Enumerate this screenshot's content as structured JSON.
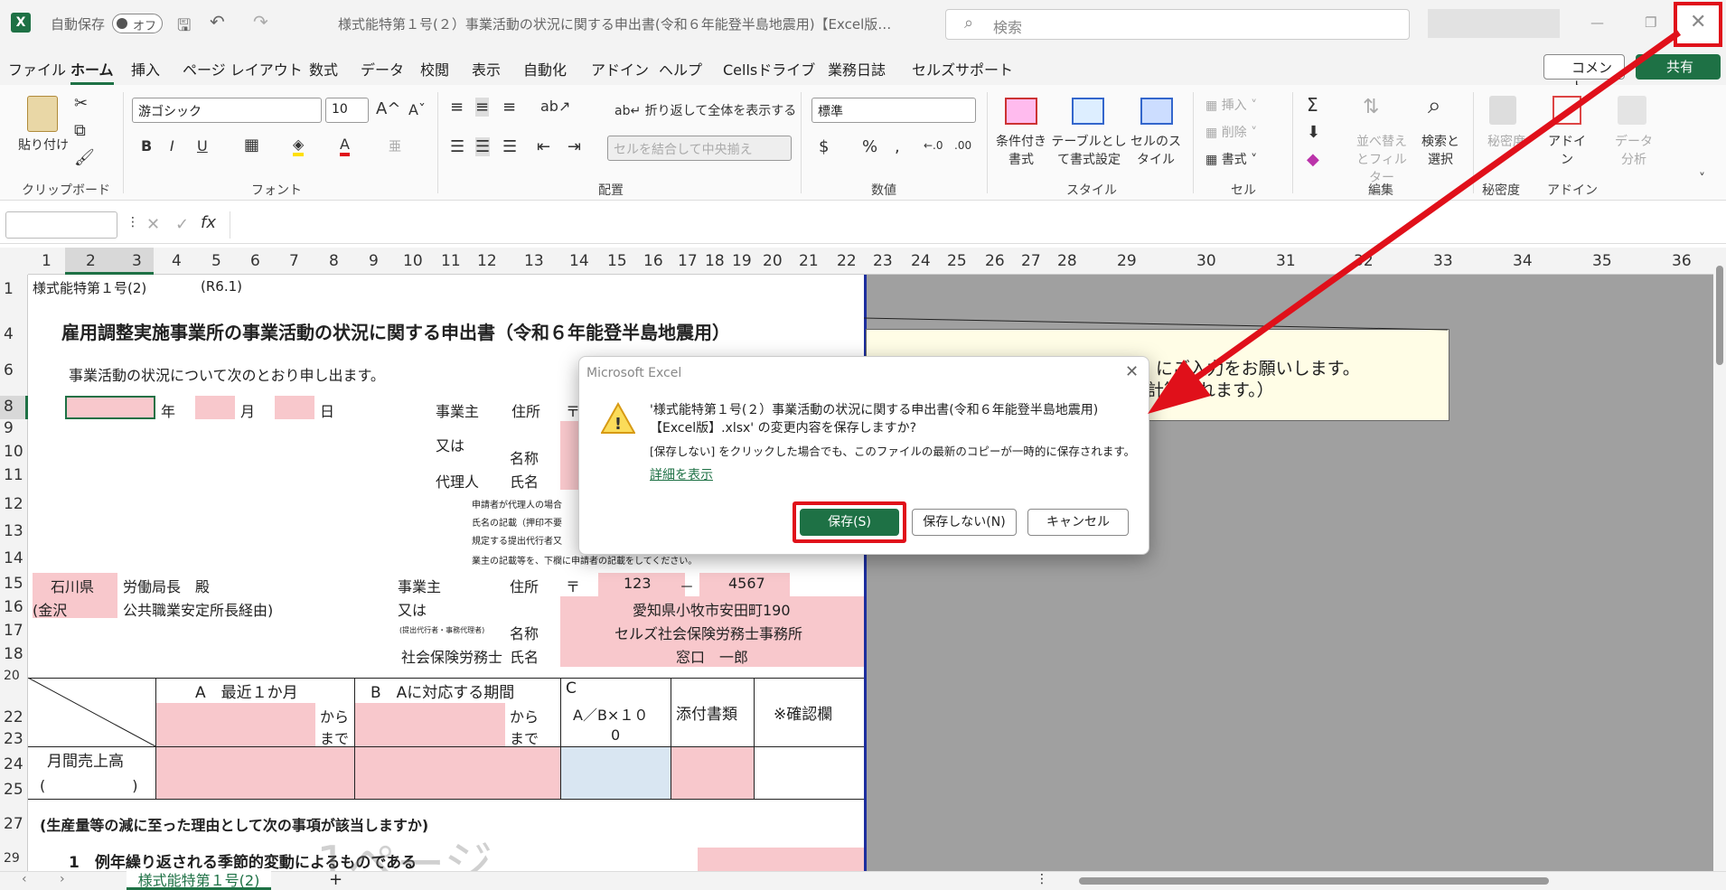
{
  "titlebar": {
    "autosave_label": "自動保存",
    "toggle_state": "オフ",
    "doc_title": "様式能特第１号(２）事業活動の状況に関する申出書(令和６年能登半島地震用)【Excel版…",
    "search_placeholder": "検索"
  },
  "menu": {
    "items": [
      "ファイル",
      "ホーム",
      "挿入",
      "ページ レイアウト",
      "数式",
      "データ",
      "校閲",
      "表示",
      "自動化",
      "アドイン",
      "ヘルプ",
      "Cellsドライブ",
      "業務日誌",
      "セルズサポート"
    ],
    "comment_label": "コメント",
    "share_label": "共有"
  },
  "ribbon": {
    "paste_label": "貼り付け",
    "clipboard_label": "クリップボード",
    "font_name": "游ゴシック",
    "font_size": "10",
    "font_group": "フォント",
    "wrap_label": "折り返して全体を表示する",
    "merge_label": "セルを結合して中央揃え",
    "align_group": "配置",
    "number_format": "標準",
    "number_group": "数値",
    "cond_label": "条件付き書式",
    "table_label": "テーブルとして書式設定",
    "cellstyle_label": "セルのスタイル",
    "style_group": "スタイル",
    "insert_label": "挿入",
    "delete_label": "削除",
    "format_label": "書式",
    "cells_group": "セル",
    "sort_label": "並べ替えとフィルター",
    "find_label": "検索と選択",
    "edit_group": "編集",
    "sensitivity_label": "秘密度",
    "sensitivity_group": "秘密度",
    "addin_label": "アドイン",
    "addin_group": "アドイン",
    "analyze_label": "データ分析"
  },
  "formula": {
    "fx": "fx"
  },
  "columns": [
    "1",
    "2",
    "3",
    "4",
    "5",
    "6",
    "7",
    "8",
    "9",
    "10",
    "11",
    "12",
    "13",
    "14",
    "15",
    "16",
    "17",
    "18",
    "19",
    "20",
    "21",
    "22",
    "23",
    "24",
    "25",
    "26",
    "27",
    "28",
    "29",
    "30",
    "31",
    "32",
    "33",
    "34",
    "35",
    "36"
  ],
  "rows": [
    "1",
    "4",
    "6",
    "8",
    "9",
    "10",
    "11",
    "12",
    "13",
    "14",
    "15",
    "16",
    "17",
    "18",
    "20",
    "22",
    "23",
    "24",
    "25",
    "27",
    "29"
  ],
  "sheet": {
    "form_id": "様式能特第１号(2)",
    "revision": "(R6.1)",
    "title": "雇用調整実施事業所の事業活動の状況に関する申出書（令和６年能登半島地震用）",
    "intro": "事業活動の状況について次のとおり申し出ます。",
    "year": "年",
    "month": "月",
    "day": "日",
    "employer": "事業主",
    "address": "住所",
    "postal": "〒",
    "or": "又は",
    "name": "名称",
    "agent": "代理人",
    "person": "氏名",
    "note1": "申請者が代理人の場合",
    "note2": "氏名の記載（押印不要",
    "note3": "規定する提出代行者又",
    "note4": "業主の記載等を、下欄に申請者の記載をしてください。",
    "prefecture": "石川県",
    "bureau": "労働局長　殿",
    "kanazawa": "(金沢",
    "office": "公共職業安定所長経由)",
    "postal1": "123",
    "dash": "－",
    "postal2": "4567",
    "addr_value": "愛知県小牧市安田町190",
    "company": "セルズ社会保険労務士事務所",
    "rep": "窓口　一郎",
    "agent_small": "(提出代行者・事務代理者)",
    "sharoshi": "社会保険労務士",
    "col_a": "A　最近１か月",
    "col_b": "B　Aに対応する期間",
    "col_c": "C",
    "formula_c": "A／B×１０",
    "formula_c2": "0",
    "attach": "添付書類",
    "confirm": "※確認欄",
    "from": "から",
    "to": "まで",
    "sales": "月間売上高",
    "paren": "(　　　　　　)",
    "reason": "(生産量等の減に至った理由として次の事項が該当しますか)",
    "item1": "1　例年繰り返される季節的変動によるものである",
    "watermark": "1ページ",
    "note_line1": "にご入力をお願いします。",
    "note_line2": "計算されます。）"
  },
  "dialog": {
    "app": "Microsoft Excel",
    "line1": "'様式能特第１号(２）事業活動の状況に関する申出書(令和６年能登半島地震用)",
    "line2": "【Excel版】.xlsx' の変更内容を保存しますか?",
    "line3": "[保存しない] をクリックした場合でも、このファイルの最新のコピーが一時的に保存されます。",
    "details": "詳細を表示",
    "save": "保存(S)",
    "dont_save": "保存しない(N)",
    "cancel": "キャンセル"
  },
  "statusbar": {
    "sheet_tab": "様式能特第１号(2)",
    "add": "+"
  },
  "colors": {
    "excel_green": "#1e7145",
    "highlight_red": "#e0101a",
    "pink_fill": "#f8c8cc",
    "page_break": "#1c2e9e"
  }
}
